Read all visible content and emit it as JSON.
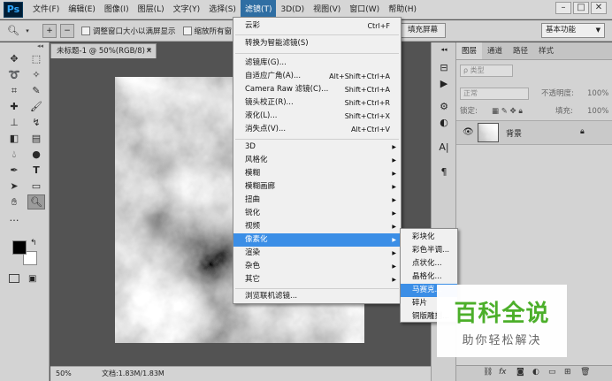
{
  "app": {
    "logo": "Ps"
  },
  "menubar": {
    "items": [
      "文件(F)",
      "编辑(E)",
      "图像(I)",
      "图层(L)",
      "文字(Y)",
      "选择(S)",
      "滤镜(T)",
      "3D(D)",
      "视图(V)",
      "窗口(W)",
      "帮助(H)"
    ],
    "active_index": 6
  },
  "options_bar": {
    "resize_windows_label": "调整窗口大小以满屏显示",
    "zoom_all_label": "缩放所有窗",
    "fill_screen_label": "填充屏幕",
    "workspace_label": "基本功能"
  },
  "document": {
    "tab_title": "未标题-1 @ 50%(RGB/8) *",
    "zoom_level": "50%",
    "doc_info": "文档:1.83M/1.83M"
  },
  "filter_menu": {
    "last_filter": {
      "label": "云彩",
      "shortcut": "Ctrl+F"
    },
    "smart": "转换为智能滤镜(S)",
    "group2": [
      {
        "label": "滤镜库(G)...",
        "shortcut": ""
      },
      {
        "label": "自适应广角(A)...",
        "shortcut": "Alt+Shift+Ctrl+A"
      },
      {
        "label": "Camera Raw 滤镜(C)...",
        "shortcut": "Shift+Ctrl+A"
      },
      {
        "label": "镜头校正(R)...",
        "shortcut": "Shift+Ctrl+R"
      },
      {
        "label": "液化(L)...",
        "shortcut": "Shift+Ctrl+X"
      },
      {
        "label": "消失点(V)...",
        "shortcut": "Alt+Ctrl+V"
      }
    ],
    "group3": [
      "3D",
      "风格化",
      "模糊",
      "模糊画廊",
      "扭曲",
      "锐化",
      "视频",
      "像素化",
      "渲染",
      "杂色",
      "其它"
    ],
    "highlight_index": 7,
    "browse": "浏览联机滤镜..."
  },
  "pixelate_submenu": {
    "items": [
      "彩块化",
      "彩色半调...",
      "点状化...",
      "晶格化...",
      "马赛克...",
      "碎片",
      "铜版雕刻..."
    ],
    "highlight_index": 4
  },
  "layers_panel": {
    "tabs": [
      "图层",
      "通道",
      "路径",
      "样式"
    ],
    "filter_kind": "ρ 类型",
    "blend_mode": "正常",
    "opacity_label": "不透明度:",
    "opacity_value": "100%",
    "lock_label": "锁定:",
    "fill_label": "填充:",
    "fill_value": "100%",
    "layer_name": "背景"
  },
  "watermark": {
    "title": "百科全说",
    "subtitle": "助你轻松解决"
  },
  "colors": {
    "accent": "#3b8ee6",
    "menu_active": "#2f6ea3",
    "watermark_green": "#4caf2a"
  }
}
